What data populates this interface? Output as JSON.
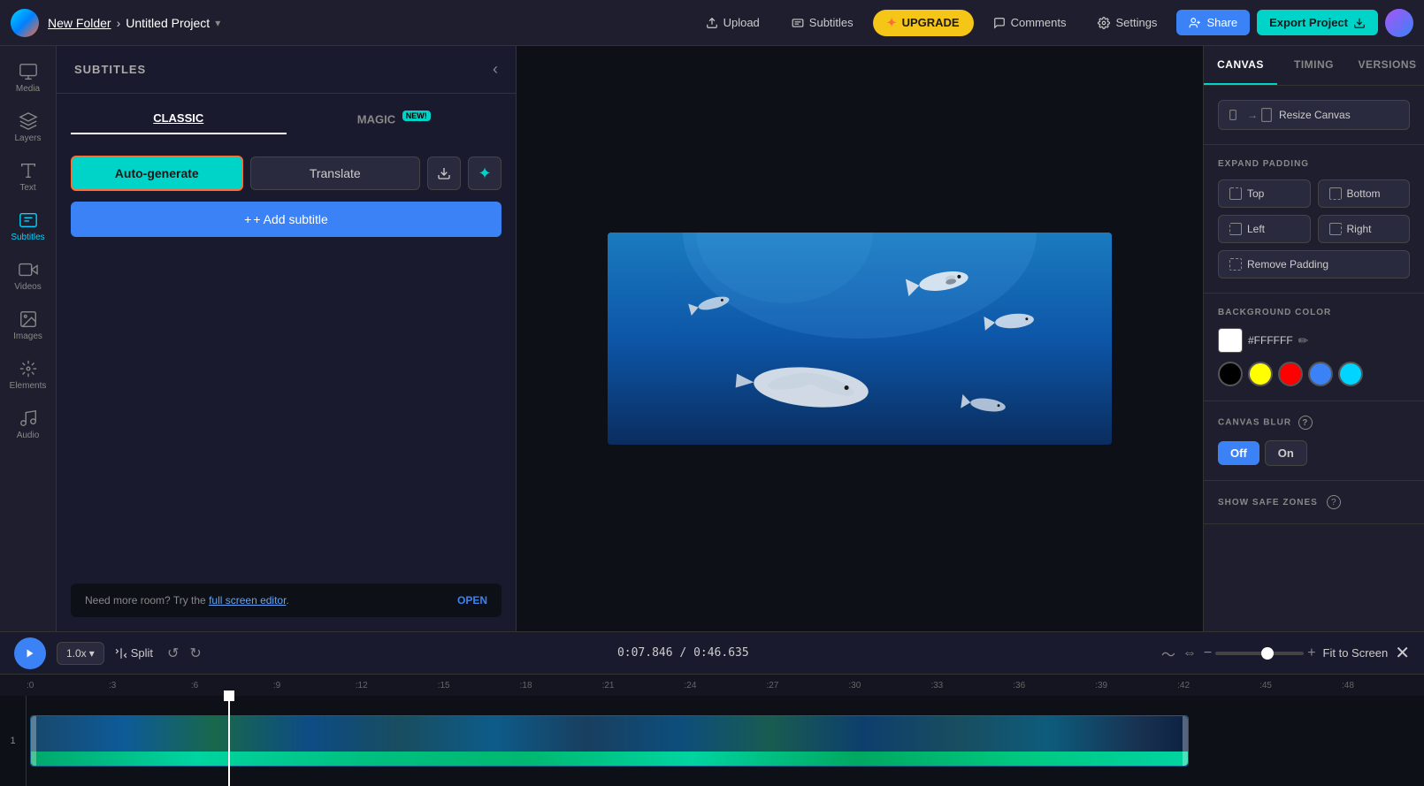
{
  "topbar": {
    "folder": "New Folder",
    "separator": "›",
    "project": "Untitled Project",
    "chevron": "▾",
    "upload": "Upload",
    "subtitles": "Subtitles",
    "upgrade": "UPGRADE",
    "upgrade_star": "✦",
    "comments": "Comments",
    "settings": "Settings",
    "share": "Share",
    "export": "Export Project"
  },
  "sidebar": {
    "items": [
      {
        "id": "media",
        "label": "Media"
      },
      {
        "id": "layers",
        "label": "Layers"
      },
      {
        "id": "text",
        "label": "Text"
      },
      {
        "id": "subtitles",
        "label": "Subtitles"
      },
      {
        "id": "videos",
        "label": "Videos"
      },
      {
        "id": "images",
        "label": "Images"
      },
      {
        "id": "elements",
        "label": "Elements"
      },
      {
        "id": "audio",
        "label": "Audio"
      }
    ]
  },
  "panel": {
    "title": "SUBTITLES",
    "close_icon": "‹",
    "tabs": [
      {
        "id": "classic",
        "label": "CLASSIC",
        "active": true
      },
      {
        "id": "magic",
        "label": "MAGIC",
        "badge": "NEW!"
      }
    ],
    "autogenerate": "Auto-generate",
    "translate": "Translate",
    "add_subtitle": "+ Add subtitle",
    "hint_text": "Need more room? Try the ",
    "hint_link": "full screen editor",
    "hint_after": ".",
    "open_btn": "OPEN"
  },
  "right_panel": {
    "tabs": [
      {
        "id": "canvas",
        "label": "CANVAS",
        "active": true
      },
      {
        "id": "timing",
        "label": "TIMING"
      },
      {
        "id": "versions",
        "label": "VERSIONS"
      }
    ],
    "resize_canvas": "Resize Canvas",
    "expand_padding": "EXPAND PADDING",
    "top": "Top",
    "bottom": "Bottom",
    "left": "Left",
    "right": "Right",
    "remove_padding": "Remove Padding",
    "background_color": "BACKGROUND COLOR",
    "color_hex": "#FFFFFF",
    "color_swatches": [
      "#000000",
      "#ffff00",
      "#ff0000",
      "#3b82f6",
      "#00d4ff"
    ],
    "canvas_blur": "CANVAS BLUR",
    "blur_off": "Off",
    "blur_on": "On",
    "show_safe_zones": "SHOW SAFE ZONES"
  },
  "timeline": {
    "play_icon": "▶",
    "speed": "1.0x",
    "split": "Split",
    "undo": "↺",
    "redo": "↻",
    "current_time": "0:07.846",
    "separator": "/",
    "total_time": "0:46.635",
    "fit_screen": "Fit to Screen",
    "close": "✕",
    "ruler_marks": [
      ":0",
      ":3",
      ":6",
      ":9",
      ":12",
      ":15",
      ":18",
      ":21",
      ":24",
      ":27",
      ":30",
      ":33",
      ":36",
      ":39",
      ":42",
      ":45",
      ":48"
    ]
  }
}
